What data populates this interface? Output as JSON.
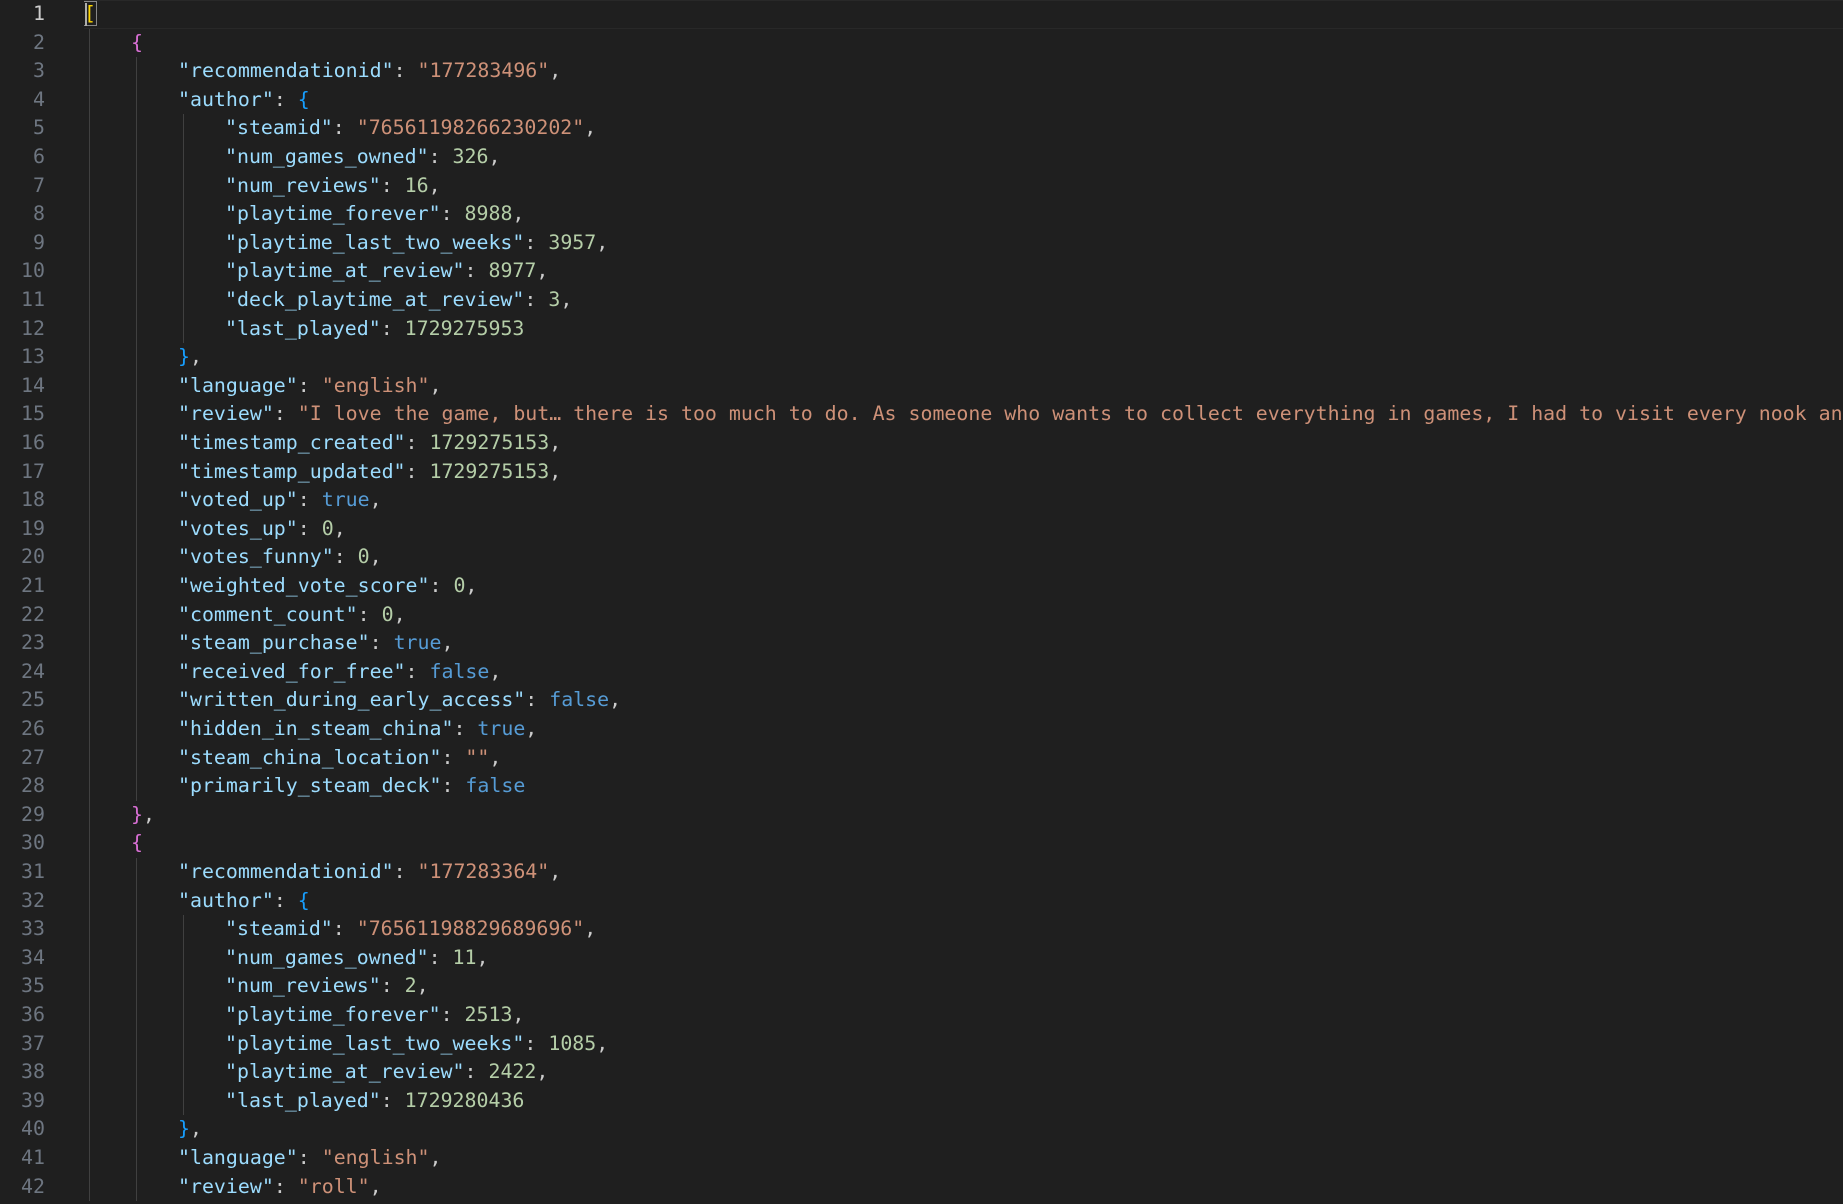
{
  "editor": {
    "language": "json",
    "colors": {
      "background": "#1f1f1f",
      "key": "#9cdcfe",
      "string": "#ce9178",
      "number": "#b5cea8",
      "boolean": "#569cd6",
      "bracket_level1": "#ffd700",
      "bracket_level2": "#da70d6",
      "bracket_level3": "#179fff"
    },
    "active_line": 1,
    "lines": [
      [
        [
          "br1",
          "["
        ]
      ],
      [
        [
          "br2",
          "{"
        ]
      ],
      [
        [
          "k",
          "\"recommendationid\""
        ],
        [
          "p",
          ": "
        ],
        [
          "s",
          "\"177283496\""
        ],
        [
          "p",
          ","
        ]
      ],
      [
        [
          "k",
          "\"author\""
        ],
        [
          "p",
          ": "
        ],
        [
          "br3",
          "{"
        ]
      ],
      [
        [
          "k",
          "\"steamid\""
        ],
        [
          "p",
          ": "
        ],
        [
          "s",
          "\"76561198266230202\""
        ],
        [
          "p",
          ","
        ]
      ],
      [
        [
          "k",
          "\"num_games_owned\""
        ],
        [
          "p",
          ": "
        ],
        [
          "n",
          "326"
        ],
        [
          "p",
          ","
        ]
      ],
      [
        [
          "k",
          "\"num_reviews\""
        ],
        [
          "p",
          ": "
        ],
        [
          "n",
          "16"
        ],
        [
          "p",
          ","
        ]
      ],
      [
        [
          "k",
          "\"playtime_forever\""
        ],
        [
          "p",
          ": "
        ],
        [
          "n",
          "8988"
        ],
        [
          "p",
          ","
        ]
      ],
      [
        [
          "k",
          "\"playtime_last_two_weeks\""
        ],
        [
          "p",
          ": "
        ],
        [
          "n",
          "3957"
        ],
        [
          "p",
          ","
        ]
      ],
      [
        [
          "k",
          "\"playtime_at_review\""
        ],
        [
          "p",
          ": "
        ],
        [
          "n",
          "8977"
        ],
        [
          "p",
          ","
        ]
      ],
      [
        [
          "k",
          "\"deck_playtime_at_review\""
        ],
        [
          "p",
          ": "
        ],
        [
          "n",
          "3"
        ],
        [
          "p",
          ","
        ]
      ],
      [
        [
          "k",
          "\"last_played\""
        ],
        [
          "p",
          ": "
        ],
        [
          "n",
          "1729275953"
        ]
      ],
      [
        [
          "br3",
          "}"
        ],
        [
          "p",
          ","
        ]
      ],
      [
        [
          "k",
          "\"language\""
        ],
        [
          "p",
          ": "
        ],
        [
          "s",
          "\"english\""
        ],
        [
          "p",
          ","
        ]
      ],
      [
        [
          "k",
          "\"review\""
        ],
        [
          "p",
          ": "
        ],
        [
          "s",
          "\"I love the game, but… there is too much to do. As someone who wants to collect everything in games, I had to visit every nook and cran"
        ]
      ],
      [
        [
          "k",
          "\"timestamp_created\""
        ],
        [
          "p",
          ": "
        ],
        [
          "n",
          "1729275153"
        ],
        [
          "p",
          ","
        ]
      ],
      [
        [
          "k",
          "\"timestamp_updated\""
        ],
        [
          "p",
          ": "
        ],
        [
          "n",
          "1729275153"
        ],
        [
          "p",
          ","
        ]
      ],
      [
        [
          "k",
          "\"voted_up\""
        ],
        [
          "p",
          ": "
        ],
        [
          "b",
          "true"
        ],
        [
          "p",
          ","
        ]
      ],
      [
        [
          "k",
          "\"votes_up\""
        ],
        [
          "p",
          ": "
        ],
        [
          "n",
          "0"
        ],
        [
          "p",
          ","
        ]
      ],
      [
        [
          "k",
          "\"votes_funny\""
        ],
        [
          "p",
          ": "
        ],
        [
          "n",
          "0"
        ],
        [
          "p",
          ","
        ]
      ],
      [
        [
          "k",
          "\"weighted_vote_score\""
        ],
        [
          "p",
          ": "
        ],
        [
          "n",
          "0"
        ],
        [
          "p",
          ","
        ]
      ],
      [
        [
          "k",
          "\"comment_count\""
        ],
        [
          "p",
          ": "
        ],
        [
          "n",
          "0"
        ],
        [
          "p",
          ","
        ]
      ],
      [
        [
          "k",
          "\"steam_purchase\""
        ],
        [
          "p",
          ": "
        ],
        [
          "b",
          "true"
        ],
        [
          "p",
          ","
        ]
      ],
      [
        [
          "k",
          "\"received_for_free\""
        ],
        [
          "p",
          ": "
        ],
        [
          "b",
          "false"
        ],
        [
          "p",
          ","
        ]
      ],
      [
        [
          "k",
          "\"written_during_early_access\""
        ],
        [
          "p",
          ": "
        ],
        [
          "b",
          "false"
        ],
        [
          "p",
          ","
        ]
      ],
      [
        [
          "k",
          "\"hidden_in_steam_china\""
        ],
        [
          "p",
          ": "
        ],
        [
          "b",
          "true"
        ],
        [
          "p",
          ","
        ]
      ],
      [
        [
          "k",
          "\"steam_china_location\""
        ],
        [
          "p",
          ": "
        ],
        [
          "s",
          "\"\""
        ],
        [
          "p",
          ","
        ]
      ],
      [
        [
          "k",
          "\"primarily_steam_deck\""
        ],
        [
          "p",
          ": "
        ],
        [
          "b",
          "false"
        ]
      ],
      [
        [
          "br2",
          "}"
        ],
        [
          "p",
          ","
        ]
      ],
      [
        [
          "br2",
          "{"
        ]
      ],
      [
        [
          "k",
          "\"recommendationid\""
        ],
        [
          "p",
          ": "
        ],
        [
          "s",
          "\"177283364\""
        ],
        [
          "p",
          ","
        ]
      ],
      [
        [
          "k",
          "\"author\""
        ],
        [
          "p",
          ": "
        ],
        [
          "br3",
          "{"
        ]
      ],
      [
        [
          "k",
          "\"steamid\""
        ],
        [
          "p",
          ": "
        ],
        [
          "s",
          "\"76561198829689696\""
        ],
        [
          "p",
          ","
        ]
      ],
      [
        [
          "k",
          "\"num_games_owned\""
        ],
        [
          "p",
          ": "
        ],
        [
          "n",
          "11"
        ],
        [
          "p",
          ","
        ]
      ],
      [
        [
          "k",
          "\"num_reviews\""
        ],
        [
          "p",
          ": "
        ],
        [
          "n",
          "2"
        ],
        [
          "p",
          ","
        ]
      ],
      [
        [
          "k",
          "\"playtime_forever\""
        ],
        [
          "p",
          ": "
        ],
        [
          "n",
          "2513"
        ],
        [
          "p",
          ","
        ]
      ],
      [
        [
          "k",
          "\"playtime_last_two_weeks\""
        ],
        [
          "p",
          ": "
        ],
        [
          "n",
          "1085"
        ],
        [
          "p",
          ","
        ]
      ],
      [
        [
          "k",
          "\"playtime_at_review\""
        ],
        [
          "p",
          ": "
        ],
        [
          "n",
          "2422"
        ],
        [
          "p",
          ","
        ]
      ],
      [
        [
          "k",
          "\"last_played\""
        ],
        [
          "p",
          ": "
        ],
        [
          "n",
          "1729280436"
        ]
      ],
      [
        [
          "br3",
          "}"
        ],
        [
          "p",
          ","
        ]
      ],
      [
        [
          "k",
          "\"language\""
        ],
        [
          "p",
          ": "
        ],
        [
          "s",
          "\"english\""
        ],
        [
          "p",
          ","
        ]
      ],
      [
        [
          "k",
          "\"review\""
        ],
        [
          "p",
          ": "
        ],
        [
          "s",
          "\"roll\""
        ],
        [
          "p",
          ","
        ]
      ]
    ]
  }
}
